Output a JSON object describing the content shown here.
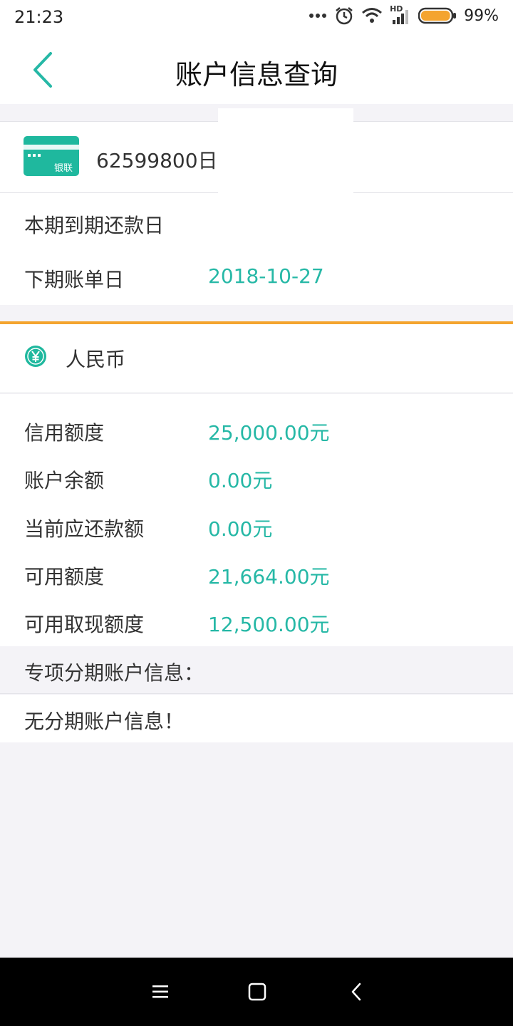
{
  "status_bar": {
    "time": "21:23",
    "battery_percent": "99%",
    "battery_level": 0.99,
    "network_label": "HD"
  },
  "header": {
    "title": "账户信息查询",
    "back_icon": "chevron-left-icon"
  },
  "card": {
    "number": "62599800",
    "number_suffix": "日",
    "brand_label": "银联",
    "brand_color": "#1fb89e"
  },
  "billing": {
    "due_date_label": "本期到期还款日",
    "due_date_value": "",
    "statement_date_label": "下期账单日",
    "statement_date_value": "2018-10-27"
  },
  "currency": {
    "label": "人民币",
    "icon": "yen-icon"
  },
  "amounts": [
    {
      "label": "信用额度",
      "value": "25,000.00元"
    },
    {
      "label": "账户余额",
      "value": "0.00元"
    },
    {
      "label": "当前应还款额",
      "value": "0.00元"
    },
    {
      "label": "可用额度",
      "value": "21,664.00元"
    },
    {
      "label": "可用取现额度",
      "value": "12,500.00元"
    }
  ],
  "installment": {
    "header": "专项分期账户信息：",
    "message": "无分期账户信息！"
  },
  "colors": {
    "accent": "#26b8a6",
    "divider_orange": "#f4a42f",
    "page_background": "#f4f3f7"
  },
  "nav_bar": {
    "menu_icon": "menu-icon",
    "home_icon": "home-square-icon",
    "back_icon": "back-chevron-icon"
  }
}
